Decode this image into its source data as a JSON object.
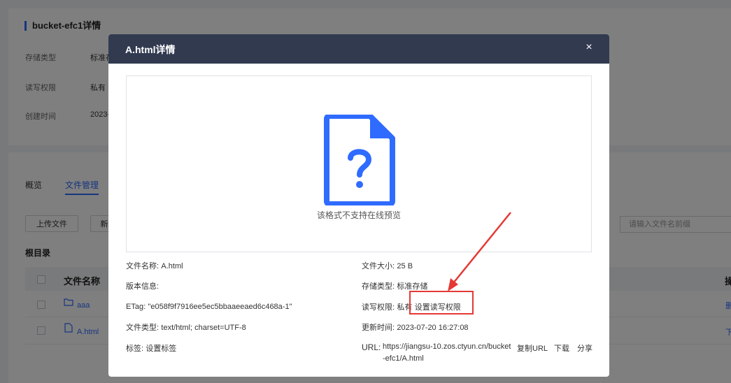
{
  "bucket": {
    "title": "bucket-efc1详情",
    "fields": [
      {
        "label": "存储类型",
        "value": "标准存"
      },
      {
        "label": "读写权限",
        "value": "私有"
      },
      {
        "label": "创建时间",
        "value": "2023-"
      }
    ]
  },
  "tabs": [
    {
      "label": "概览",
      "active": false
    },
    {
      "label": "文件管理",
      "active": true
    }
  ],
  "toolbar": {
    "upload_label": "上传文件",
    "new_label": "新",
    "search_placeholder": "请输入文件名前缀"
  },
  "root_dir_label": "根目录",
  "table": {
    "header_name": "文件名称",
    "header_op": "操",
    "rows": [
      {
        "name": "aaa",
        "type": "folder",
        "action": "删"
      },
      {
        "name": "A.html",
        "type": "file",
        "action": "下"
      }
    ]
  },
  "modal": {
    "title": "A.html详情",
    "close_glyph": "×",
    "preview_text": "该格式不支持在线预览",
    "meta": {
      "file_name_label": "文件名称:",
      "file_name": "A.html",
      "version_label": "版本信息:",
      "version": "",
      "etag_label": "ETag:",
      "etag": "\"e058f9f7916ee5ec5bbaaeeaed6c468a-1\"",
      "file_type_label": "文件类型:",
      "file_type": "text/html; charset=UTF-8",
      "tag_label": "标签:",
      "tag_link": "设置标签",
      "file_size_label": "文件大小:",
      "file_size": "25 B",
      "storage_label": "存储类型:",
      "storage": "标准存储",
      "acl_label": "读写权限:",
      "acl": "私有",
      "acl_link": "设置读写权限",
      "updated_label": "更新时间:",
      "updated": "2023-07-20 16:27:08",
      "url_label": "URL:",
      "url_line1": "https://jiangsu-10.zos.ctyun.cn/bucket",
      "url_line2": "-efc1/A.html",
      "copy_url": "复制URL",
      "download": "下载",
      "share": "分享"
    }
  },
  "colors": {
    "accent": "#2f6bff",
    "modal_header": "#313a4f",
    "highlight": "#e53935"
  },
  "icons": {
    "preview": "unknown-file-icon",
    "folder": "folder-icon",
    "file": "file-icon"
  }
}
